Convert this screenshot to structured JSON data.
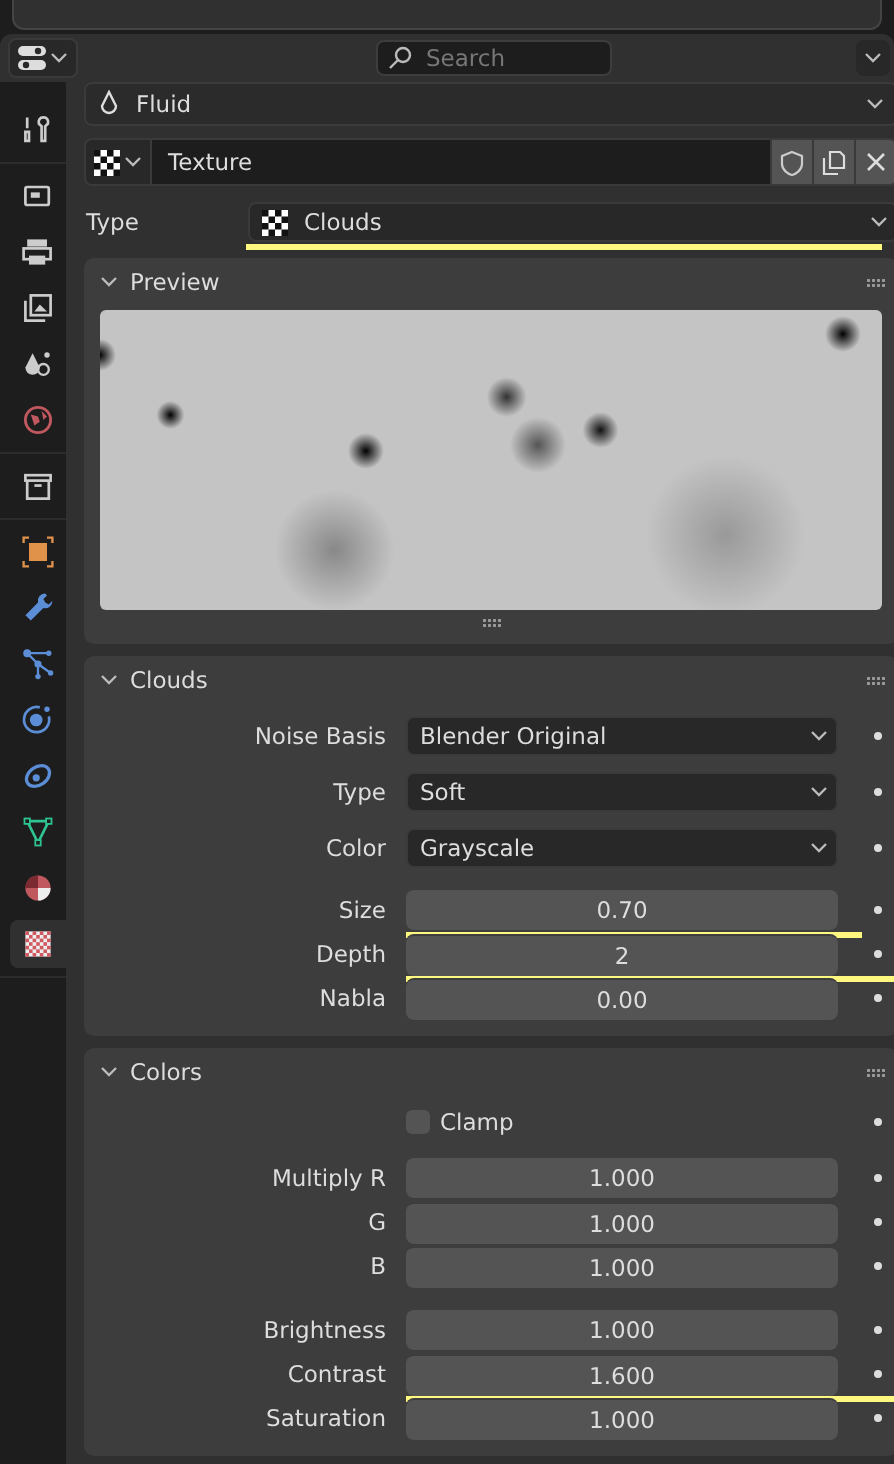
{
  "header": {
    "search": {
      "placeholder": "Search"
    }
  },
  "sidebar": {
    "groups": [
      [
        {
          "kind": "tool",
          "color": "#cccccc",
          "selected": false
        }
      ],
      [
        {
          "kind": "render",
          "color": "#cccccc",
          "selected": false
        },
        {
          "kind": "output",
          "color": "#cccccc",
          "selected": false
        },
        {
          "kind": "view_layer",
          "color": "#cccccc",
          "selected": false
        },
        {
          "kind": "scene",
          "color": "#cccccc",
          "selected": false
        },
        {
          "kind": "world",
          "color": "#c0585f",
          "selected": false
        }
      ],
      [
        {
          "kind": "collection",
          "color": "#cccccc",
          "selected": false
        }
      ],
      [
        {
          "kind": "object",
          "color": "#e0914a",
          "selected": false
        },
        {
          "kind": "modifier",
          "color": "#5b8ed6",
          "selected": false
        },
        {
          "kind": "particles",
          "color": "#5b8ed6",
          "selected": false
        },
        {
          "kind": "physics",
          "color": "#5b8ed6",
          "selected": false
        },
        {
          "kind": "constraints",
          "color": "#5b8ed6",
          "selected": false
        },
        {
          "kind": "data",
          "color": "#2ec48f",
          "selected": false
        },
        {
          "kind": "material",
          "color": "#c0585f",
          "selected": false
        },
        {
          "kind": "texture",
          "color": "#d0585f",
          "selected": true
        }
      ]
    ]
  },
  "context": {
    "label": "Fluid"
  },
  "texture": {
    "name": "Texture"
  },
  "type_field": {
    "label": "Type",
    "value": "Clouds",
    "highlighted": true
  },
  "panels": [
    {
      "kind": "preview",
      "title": "Preview",
      "expanded": true
    },
    {
      "kind": "form",
      "title": "Clouds",
      "expanded": true,
      "groups": [
        [
          {
            "kind": "dropdown",
            "label": "Noise Basis",
            "value": "Blender Original",
            "highlighted": false
          },
          {
            "kind": "dropdown",
            "label": "Type",
            "value": "Soft",
            "highlighted": false
          },
          {
            "kind": "dropdown",
            "label": "Color",
            "value": "Grayscale",
            "highlighted": false
          }
        ],
        [
          {
            "kind": "number",
            "label": "Size",
            "value": "0.70",
            "highlighted": true
          },
          {
            "kind": "number",
            "label": "Depth",
            "value": "2",
            "highlighted": true
          },
          {
            "kind": "number",
            "label": "Nabla",
            "value": "0.00",
            "highlighted": false
          }
        ]
      ]
    },
    {
      "kind": "form",
      "title": "Colors",
      "expanded": true,
      "groups": [
        [
          {
            "kind": "checkbox",
            "label": "Clamp",
            "checked": false,
            "highlighted": false
          }
        ],
        [
          {
            "kind": "number",
            "label": "Multiply R",
            "value": "1.000",
            "highlighted": false
          },
          {
            "kind": "number",
            "label": "G",
            "value": "1.000",
            "highlighted": false
          },
          {
            "kind": "number",
            "label": "B",
            "value": "1.000",
            "highlighted": false
          }
        ],
        [
          {
            "kind": "number",
            "label": "Brightness",
            "value": "1.000",
            "highlighted": false
          },
          {
            "kind": "number",
            "label": "Contrast",
            "value": "1.600",
            "highlighted": true
          },
          {
            "kind": "number",
            "label": "Saturation",
            "value": "1.000",
            "highlighted": false
          }
        ]
      ]
    }
  ]
}
